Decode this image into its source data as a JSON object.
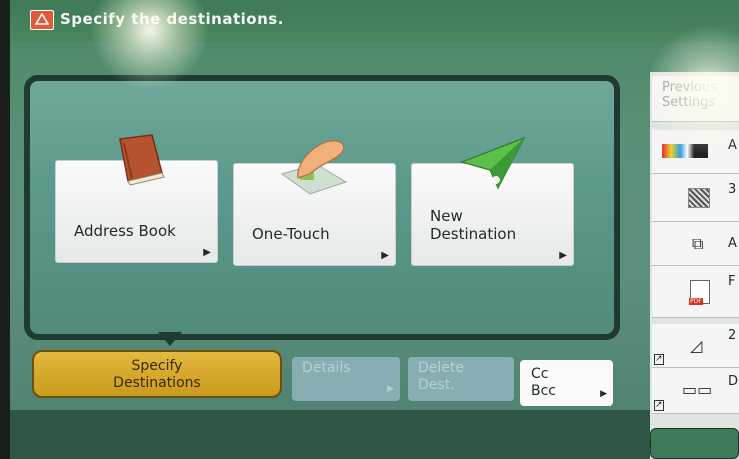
{
  "header": {
    "message": "Specify the destinations."
  },
  "tiles": [
    {
      "label_line1": "Address Book",
      "label_line2": "",
      "icon": "address-book-icon"
    },
    {
      "label_line1": "One-Touch",
      "label_line2": "",
      "icon": "one-touch-hand-icon"
    },
    {
      "label_line1": "New",
      "label_line2": "Destination",
      "icon": "paper-plane-icon"
    }
  ],
  "bottom_buttons": {
    "specify": {
      "line1": "Specify",
      "line2": "Destinations"
    },
    "details": {
      "line1": "Details"
    },
    "delete": {
      "line1": "Delete",
      "line2": "Dest."
    },
    "ccbcc": {
      "line1": "Cc",
      "line2": "Bcc"
    }
  },
  "sidebar": {
    "previous_settings": {
      "line1": "Previous",
      "line2": "Settings"
    },
    "items": [
      {
        "icon": "color-mode-icon",
        "text": "A"
      },
      {
        "icon": "resolution-icon",
        "text": "3"
      },
      {
        "icon": "copy-mode-icon",
        "text": "A"
      },
      {
        "icon": "pdf-icon",
        "text": "F"
      },
      {
        "icon": "original-size-icon",
        "text": "2"
      },
      {
        "icon": "duplex-icon",
        "text": "D"
      }
    ]
  },
  "colors": {
    "accent_yellow": "#d8ad2f",
    "panel_dark": "#1f3a2e",
    "warning_red": "#e05a3a"
  }
}
